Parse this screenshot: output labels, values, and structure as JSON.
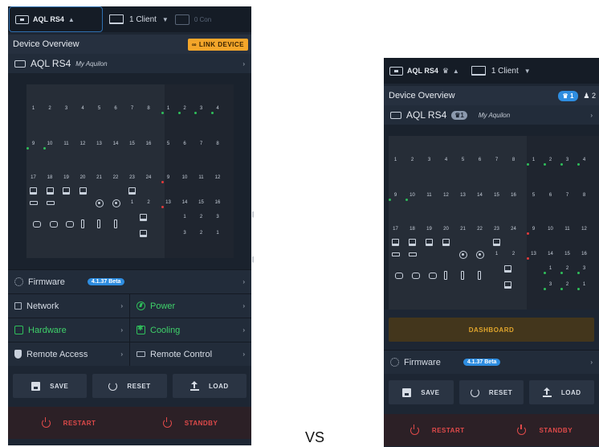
{
  "left": {
    "device_name": "AQL RS4",
    "client_label": "1 Client",
    "connections_label": "0 Con",
    "section_title": "Device Overview",
    "link_button": "LINK DEVICE",
    "model": "AQL RS4",
    "alias": "My Aquilon",
    "firmware_label": "Firmware",
    "firmware_version": "4.1.37 Beta",
    "network_label": "Network",
    "power_label": "Power",
    "hardware_label": "Hardware",
    "cooling_label": "Cooling",
    "remote_access_label": "Remote Access",
    "remote_control_label": "Remote Control",
    "save_label": "SAVE",
    "reset_label": "RESET",
    "load_label": "LOAD",
    "restart_label": "RESTART",
    "standby_label": "STANDBY"
  },
  "right": {
    "device_name": "AQL RS4",
    "client_label": "1 Client",
    "section_title": "Device Overview",
    "badge_count": "1",
    "user_count": "2",
    "model": "AQL RS4",
    "model_badge": "1",
    "alias": "My Aquilon",
    "dashboard_label": "DASHBOARD",
    "firmware_label": "Firmware",
    "firmware_version": "4.1.37 Beta",
    "save_label": "SAVE",
    "reset_label": "RESET",
    "load_label": "LOAD",
    "restart_label": "RESTART",
    "standby_label": "STANDBY"
  },
  "ports": {
    "row1": [
      "1",
      "2",
      "3",
      "4",
      "5",
      "6",
      "7",
      "8",
      "1",
      "2",
      "3",
      "4"
    ],
    "row2": [
      "9",
      "10",
      "11",
      "12",
      "13",
      "14",
      "15",
      "16",
      "5",
      "6",
      "7",
      "8"
    ],
    "row3": [
      "17",
      "18",
      "19",
      "20",
      "21",
      "22",
      "23",
      "24",
      "9",
      "10",
      "11",
      "12"
    ],
    "row5_right": [
      "1",
      "2",
      "13",
      "14",
      "15",
      "16"
    ],
    "out_left_top": [
      "1",
      "2",
      "3"
    ],
    "out_left_bottom": [
      "3",
      "2",
      "1"
    ]
  },
  "vs_label": "VS",
  "icons": [
    "device-icon",
    "caret-up-icon",
    "laptop-icon",
    "caret-down-icon",
    "link-icon",
    "chevron-right-icon",
    "gear-icon",
    "network-icon",
    "power-icon",
    "hardware-icon",
    "cooling-icon",
    "shield-icon",
    "remote-icon",
    "save-icon",
    "reset-icon",
    "upload-icon",
    "power-off-icon",
    "crown-icon",
    "user-icon"
  ],
  "colors": {
    "panel": "#1d2633",
    "accent_blue": "#2e8de0",
    "warning": "#f4a62a",
    "green": "#2fbf5b",
    "red": "#e04a4a"
  }
}
